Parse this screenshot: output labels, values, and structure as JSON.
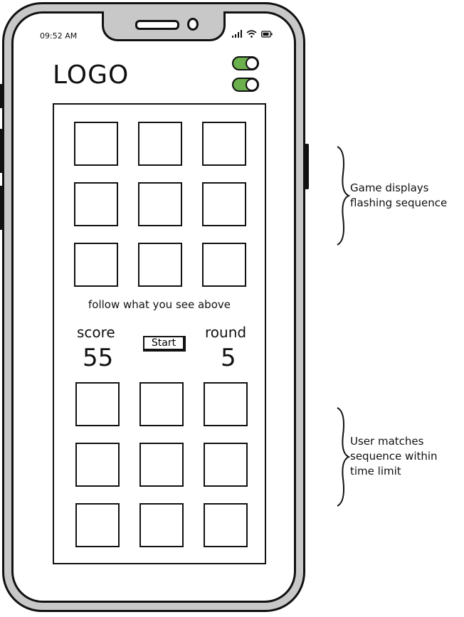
{
  "status_bar": {
    "time": "09:52 AM",
    "icons": [
      "signal-icon",
      "wifi-icon",
      "battery-icon"
    ]
  },
  "header": {
    "logo": "LOGO",
    "toggles": [
      {
        "name": "toggle-1",
        "on": true
      },
      {
        "name": "toggle-2",
        "on": true
      }
    ]
  },
  "game": {
    "instruction": "follow what you see above",
    "score_label": "score",
    "score_value": "55",
    "round_label": "round",
    "round_value": "5",
    "start_label": "Start",
    "display_tile_count": 9,
    "input_tile_count": 9
  },
  "annotations": {
    "display_note": "Game displays flashing sequence",
    "display_note_lines": [
      "Game displays",
      "flashing sequence"
    ],
    "input_note_lines": [
      "User matches",
      "sequence within",
      "time limit"
    ]
  },
  "colors": {
    "toggle_on": "#6ab04c",
    "frame": "#c8c8c8",
    "ink": "#111111"
  }
}
